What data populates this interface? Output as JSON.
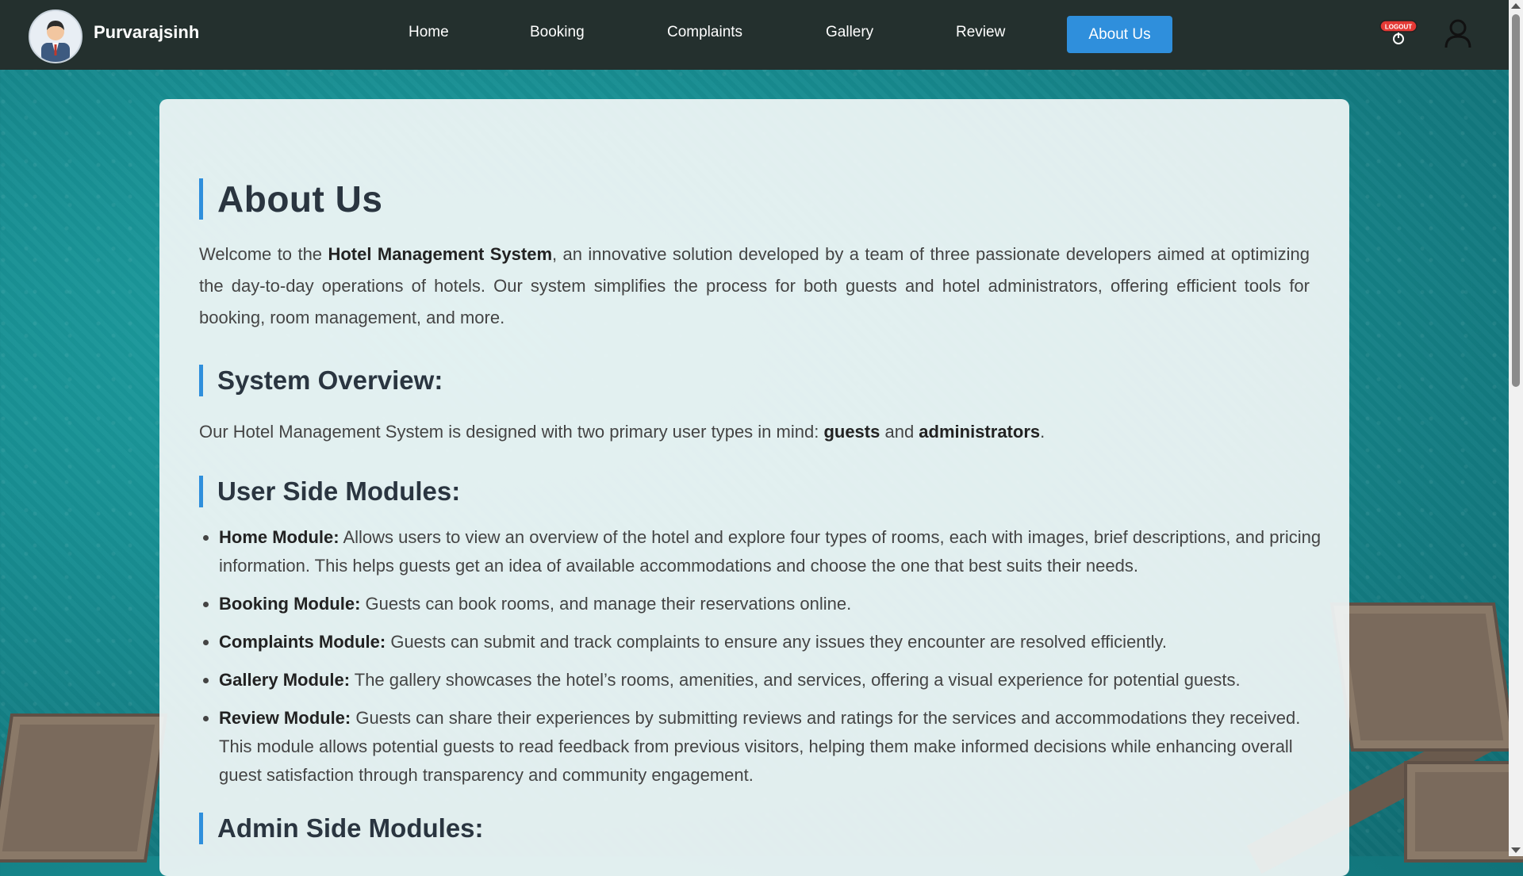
{
  "navbar": {
    "username": "Purvarajsinh",
    "links": [
      "Home",
      "Booking",
      "Complaints",
      "Gallery",
      "Review"
    ],
    "active_link": "About Us",
    "logout_label": "LOGOUT",
    "accent_color": "#2f8fdc"
  },
  "about": {
    "title": "About Us",
    "intro_prefix": "Welcome to the ",
    "intro_bold": "Hotel Management System",
    "intro_suffix": ", an innovative solution developed by a team of three passionate developers aimed at optimizing the day-to-day operations of hotels. Our system simplifies the process for both guests and hotel administrators, offering efficient tools for booking, room management, and more."
  },
  "overview": {
    "title": "System Overview:",
    "text_prefix": "Our Hotel Management System is designed with two primary user types in mind: ",
    "guests": "guests",
    "and": " and ",
    "admins": "administrators",
    "period": "."
  },
  "user_modules": {
    "title": "User Side Modules:",
    "items": [
      {
        "name": "Home Module:",
        "text": " Allows users to view an overview of the hotel and explore four types of rooms, each with images, brief descriptions, and pricing information. This helps guests get an idea of available accommodations and choose the one that best suits their needs."
      },
      {
        "name": "Booking Module:",
        "text": " Guests can book rooms, and manage their reservations online."
      },
      {
        "name": "Complaints Module:",
        "text": " Guests can submit and track complaints to ensure any issues they encounter are resolved efficiently."
      },
      {
        "name": "Gallery Module:",
        "text": " The gallery showcases the hotel’s rooms, amenities, and services, offering a visual experience for potential guests."
      },
      {
        "name": "Review Module:",
        "text": " Guests can share their experiences by submitting reviews and ratings for the services and accommodations they received. This module allows potential guests to read feedback from previous visitors, helping them make informed decisions while enhancing overall guest satisfaction through transparency and community engagement."
      }
    ]
  },
  "admin_modules": {
    "title": "Admin Side Modules:"
  }
}
